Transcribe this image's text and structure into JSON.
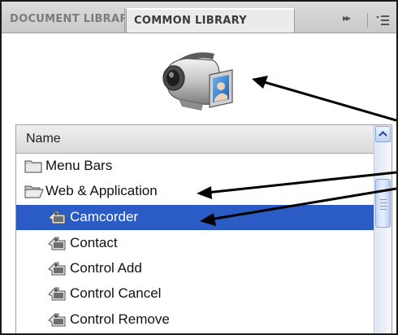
{
  "tabs": [
    {
      "label": "DOCUMENT LIBRARY",
      "active": false
    },
    {
      "label": "COMMON LIBRARY",
      "active": true
    }
  ],
  "tab_controls": {
    "collapse_glyph": "▸▸",
    "options_icon": "panel-options-menu-icon"
  },
  "preview": {
    "icon": "camcorder-icon"
  },
  "list": {
    "header": "Name",
    "items": [
      {
        "label": "Menu Bars",
        "icon": "folder-closed-icon",
        "indent": 0,
        "selected": false
      },
      {
        "label": "Web & Application",
        "icon": "folder-open-icon",
        "indent": 0,
        "selected": false
      },
      {
        "label": "Camcorder",
        "icon": "movieclip-symbol-icon",
        "indent": 1,
        "selected": true
      },
      {
        "label": "Contact",
        "icon": "movieclip-symbol-icon",
        "indent": 1,
        "selected": false
      },
      {
        "label": "Control Add",
        "icon": "movieclip-symbol-icon",
        "indent": 1,
        "selected": false
      },
      {
        "label": "Control Cancel",
        "icon": "movieclip-symbol-icon",
        "indent": 1,
        "selected": false
      },
      {
        "label": "Control Remove",
        "icon": "movieclip-symbol-icon",
        "indent": 1,
        "selected": false
      }
    ]
  },
  "colors": {
    "selection": "#2b5cc6",
    "tab_bar": "#d2d2d2",
    "annotation_arrow": "#000000"
  }
}
